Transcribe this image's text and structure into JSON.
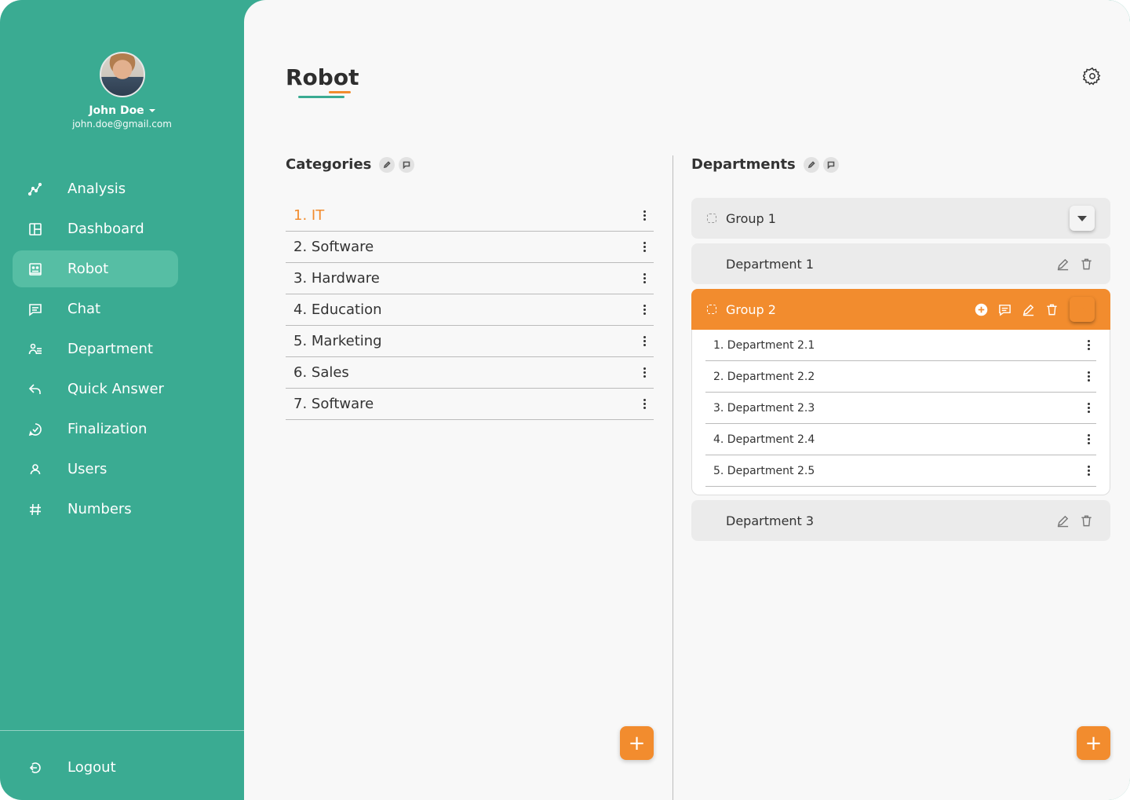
{
  "user": {
    "name": "John Doe",
    "email": "john.doe@gmail.com"
  },
  "nav": {
    "items": [
      {
        "label": "Analysis",
        "icon": "analysis-icon"
      },
      {
        "label": "Dashboard",
        "icon": "dashboard-icon"
      },
      {
        "label": "Robot",
        "icon": "robot-icon",
        "active": true
      },
      {
        "label": "Chat",
        "icon": "chat-icon"
      },
      {
        "label": "Department",
        "icon": "department-icon"
      },
      {
        "label": "Quick Answer",
        "icon": "reply-icon"
      },
      {
        "label": "Finalization",
        "icon": "check-circle-icon"
      },
      {
        "label": "Users",
        "icon": "user-icon"
      },
      {
        "label": "Numbers",
        "icon": "hashtag-icon"
      }
    ],
    "logout_label": "Logout"
  },
  "page": {
    "title": "Robot"
  },
  "categories": {
    "title": "Categories",
    "items": [
      "1. IT",
      "2. Software",
      "3. Hardware",
      "4. Education",
      "5. Marketing",
      "6. Sales",
      "7. Software"
    ],
    "active_index": 0
  },
  "departments": {
    "title": "Departments",
    "group1": {
      "label": "Group 1"
    },
    "department1": {
      "label": "Department 1"
    },
    "group2": {
      "label": "Group 2",
      "items": [
        "1. Department 2.1",
        "2. Department 2.2",
        "3. Department 2.3",
        "4. Department 2.4",
        "5. Department 2.5"
      ]
    },
    "department3": {
      "label": "Department 3"
    }
  },
  "fab_label": "+",
  "colors": {
    "sidebar": "#3aab92",
    "accent": "#f28c2e",
    "active_nav": "#56bea4",
    "background": "#f8f8f8"
  }
}
